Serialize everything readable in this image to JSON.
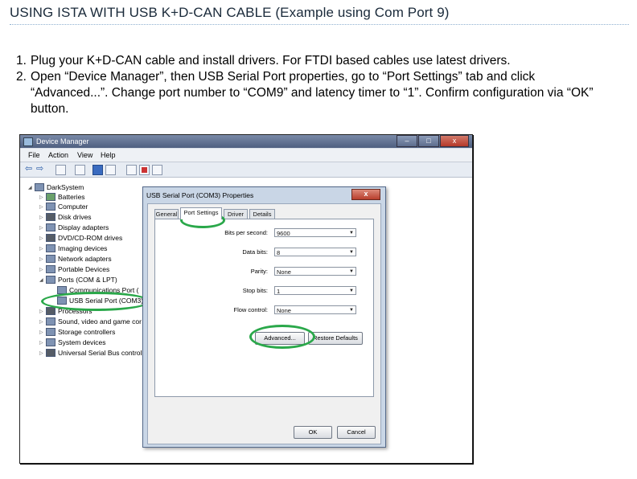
{
  "doc": {
    "title": "USING ISTA WITH USB K+D-CAN CABLE (Example using Com Port 9)",
    "steps": [
      {
        "num": "1.",
        "text": "Plug your K+D-CAN cable and install drivers. For FTDI based cables use latest drivers."
      },
      {
        "num": "2.",
        "text": "Open “Device Manager”, then USB Serial Port properties, go to “Port Settings” tab and click “Advanced...”. Change port number to “COM9” and latency timer to “1”. Confirm configuration via “OK” button."
      }
    ]
  },
  "device_manager": {
    "title": "Device Manager",
    "window_buttons": {
      "minimize": "–",
      "maximize": "□",
      "close": "x"
    },
    "menu": [
      "File",
      "Action",
      "View",
      "Help"
    ],
    "toolbar_icons": [
      "back-arrow-icon",
      "forward-arrow-icon",
      "properties-icon",
      "help-icon",
      "update-driver-icon",
      "uninstall-icon",
      "scan-hardware-icon"
    ],
    "tree": [
      {
        "label": "DarkSystem",
        "expander": "◢",
        "icon": "computer-icon"
      },
      {
        "label": "Batteries",
        "expander": "▷",
        "icon": "battery-icon"
      },
      {
        "label": "Computer",
        "expander": "▷",
        "icon": "computer-icon"
      },
      {
        "label": "Disk drives",
        "expander": "▷",
        "icon": "disk-icon"
      },
      {
        "label": "Display adapters",
        "expander": "▷",
        "icon": "display-icon"
      },
      {
        "label": "DVD/CD-ROM drives",
        "expander": "▷",
        "icon": "dvd-icon"
      },
      {
        "label": "Imaging devices",
        "expander": "▷",
        "icon": "camera-icon"
      },
      {
        "label": "Network adapters",
        "expander": "▷",
        "icon": "network-icon"
      },
      {
        "label": "Portable Devices",
        "expander": "▷",
        "icon": "device-icon"
      },
      {
        "label": "Ports (COM & LPT)",
        "expander": "◢",
        "icon": "port-icon"
      },
      {
        "label": "Communications Port (",
        "expander": "",
        "icon": "port-icon"
      },
      {
        "label": "USB Serial Port (COM3)",
        "expander": "",
        "icon": "port-icon"
      },
      {
        "label": "Processors",
        "expander": "▷",
        "icon": "processor-icon"
      },
      {
        "label": "Sound, video and game cor",
        "expander": "▷",
        "icon": "speaker-icon"
      },
      {
        "label": "Storage controllers",
        "expander": "▷",
        "icon": "storage-icon"
      },
      {
        "label": "System devices",
        "expander": "▷",
        "icon": "system-icon"
      },
      {
        "label": "Universal Serial Bus controll",
        "expander": "▷",
        "icon": "usb-icon"
      }
    ]
  },
  "dialog": {
    "title": "USB Serial Port (COM3) Properties",
    "close": "x",
    "tabs": [
      "General",
      "Port Settings",
      "Driver",
      "Details"
    ],
    "fields": [
      {
        "label": "Bits per second:",
        "value": "9600"
      },
      {
        "label": "Data bits:",
        "value": "8"
      },
      {
        "label": "Parity:",
        "value": "None"
      },
      {
        "label": "Stop bits:",
        "value": "1"
      },
      {
        "label": "Flow control:",
        "value": "None"
      }
    ],
    "advanced_button": "Advanced...",
    "restore_button": "Restore Defaults",
    "ok_button": "OK",
    "cancel_button": "Cancel"
  },
  "annotation_color": "#2aa84a"
}
